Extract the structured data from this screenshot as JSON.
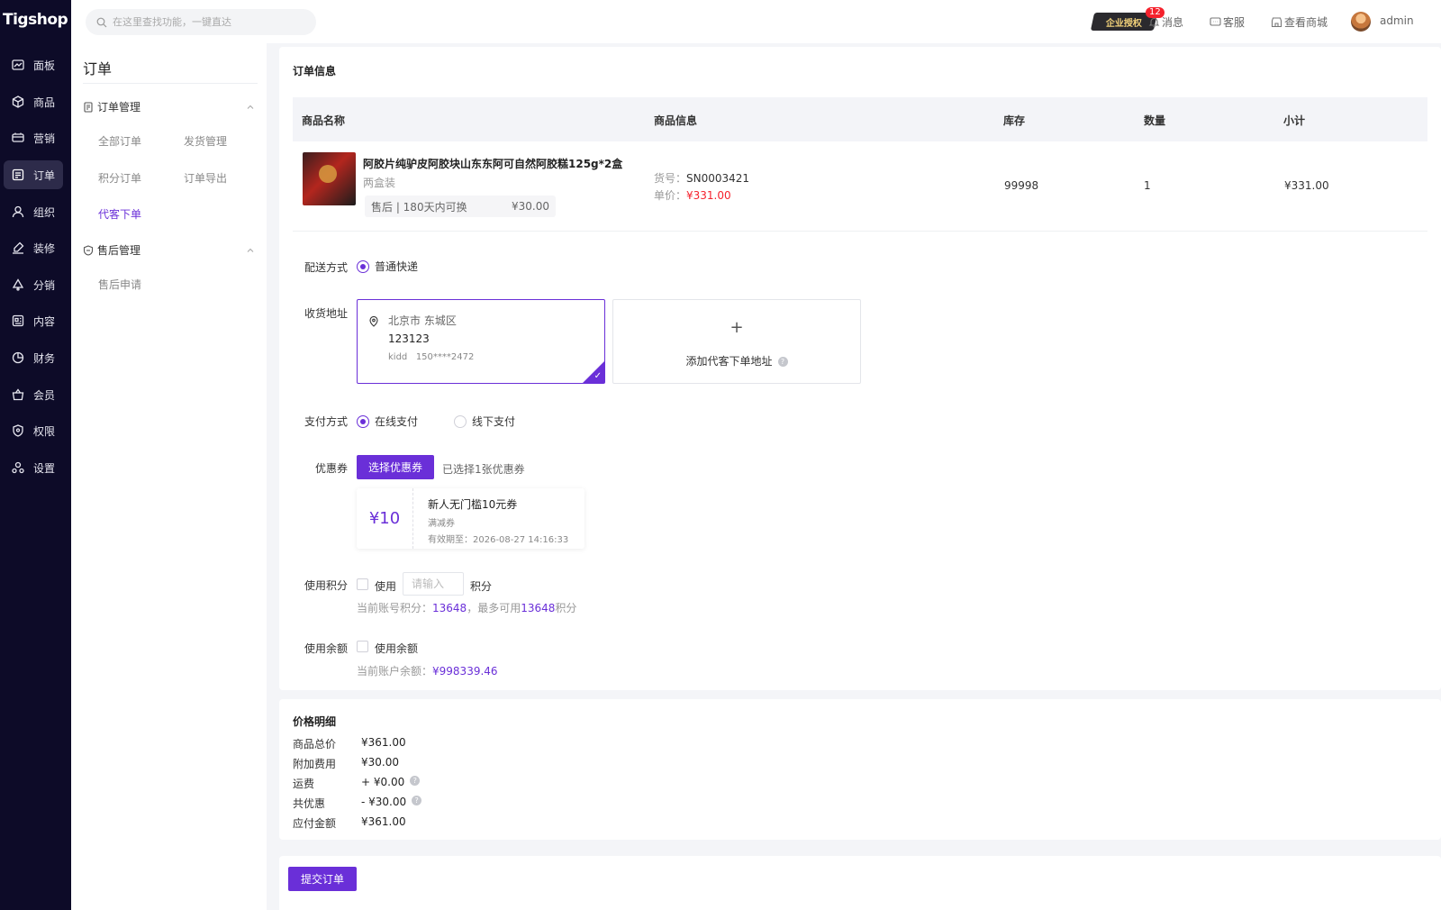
{
  "app": {
    "logo": "Tigshop"
  },
  "nav": [
    {
      "label": "面板",
      "icon": "dashboard-icon"
    },
    {
      "label": "商品",
      "icon": "box-icon"
    },
    {
      "label": "营销",
      "icon": "marketing-icon"
    },
    {
      "label": "订单",
      "icon": "order-icon",
      "active": true
    },
    {
      "label": "组织",
      "icon": "user-icon"
    },
    {
      "label": "装修",
      "icon": "brush-icon"
    },
    {
      "label": "分销",
      "icon": "distribution-icon"
    },
    {
      "label": "内容",
      "icon": "content-icon"
    },
    {
      "label": "财务",
      "icon": "finance-icon"
    },
    {
      "label": "会员",
      "icon": "member-icon"
    },
    {
      "label": "权限",
      "icon": "shield-icon"
    },
    {
      "label": "设置",
      "icon": "settings-icon"
    }
  ],
  "header": {
    "search_placeholder": "在这里查找功能，一键直达",
    "auth_badge": "企业授权",
    "message_count": "12",
    "message_label": "消息",
    "service_label": "客服",
    "store_label": "查看商城",
    "username": "admin"
  },
  "subnav": {
    "title": "订单",
    "group1": {
      "title": "订单管理",
      "items": [
        "全部订单",
        "发货管理",
        "积分订单",
        "订单导出",
        "代客下单"
      ]
    },
    "group2": {
      "title": "售后管理",
      "items": [
        "售后申请"
      ]
    }
  },
  "order": {
    "section_title": "订单信息",
    "columns": [
      "商品名称",
      "商品信息",
      "库存",
      "数量",
      "小计"
    ],
    "item": {
      "name": "阿胶片纯驴皮阿胶块山东东阿可自然阿胶糕125g*2盒",
      "spec": "两盒装",
      "after_sale": "售后 | 180天内可换",
      "after_sale_price": "¥30.00",
      "sku_label": "货号：",
      "sku": "SN0003421",
      "unit_price_label": "单价：",
      "unit_price": "¥331.00",
      "stock": "99998",
      "qty": "1",
      "subtotal": "¥331.00"
    }
  },
  "form": {
    "shipping_label": "配送方式",
    "shipping_option": "普通快递",
    "address_label": "收货地址",
    "address": {
      "region": "北京市 东城区",
      "detail": "123123",
      "contact": "kidd",
      "phone": "150****2472"
    },
    "add_address": "添加代客下单地址",
    "payment_label": "支付方式",
    "payment_online": "在线支付",
    "payment_offline": "线下支付",
    "coupon_label": "优惠券",
    "coupon_button": "选择优惠券",
    "coupon_selected": "已选择1张优惠券",
    "coupon": {
      "amount": "¥10",
      "name": "新人无门槛10元券",
      "type": "满减券",
      "expire": "有效期至：2026-08-27 14:16:33"
    },
    "points_label": "使用积分",
    "points_use": "使用",
    "points_placeholder": "请输入",
    "points_unit": "积分",
    "points_hint_prefix": "当前账号积分：",
    "points_total": "13648",
    "points_hint_mid": "，最多可用",
    "points_max": "13648",
    "points_hint_suffix": "积分",
    "balance_label": "使用余额",
    "balance_use": "使用余额",
    "balance_hint_prefix": "当前账户余额：",
    "balance_value": "¥998339.46"
  },
  "price": {
    "title": "价格明细",
    "rows": [
      {
        "k": "商品总价",
        "v": "¥361.00"
      },
      {
        "k": "附加费用",
        "v": "¥30.00"
      },
      {
        "k": "运费",
        "v": "+ ¥0.00"
      },
      {
        "k": "共优惠",
        "v": "- ¥30.00"
      },
      {
        "k": "应付金额",
        "v": "¥361.00"
      }
    ]
  },
  "submit_label": "提交订单",
  "colors": {
    "primary": "#6a2fd8",
    "nav_bg": "#0d0b28",
    "price_red": "#f5222d"
  }
}
